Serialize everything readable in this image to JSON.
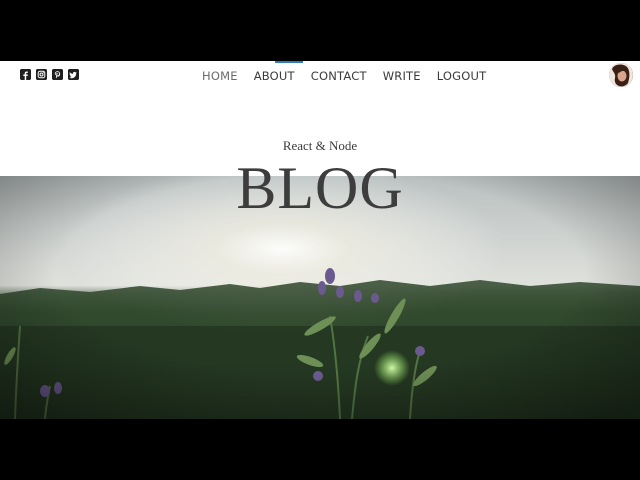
{
  "social": {
    "icons": [
      "facebook-square-icon",
      "instagram-icon",
      "pinterest-square-icon",
      "twitter-square-icon"
    ]
  },
  "nav": {
    "items": [
      {
        "label": "HOME"
      },
      {
        "label": "ABOUT"
      },
      {
        "label": "CONTACT"
      },
      {
        "label": "WRITE"
      },
      {
        "label": "LOGOUT"
      }
    ]
  },
  "header": {
    "subtitle": "React & Node",
    "title": "BLOG"
  },
  "colors": {
    "background": "#ffffff",
    "text": "#3d3d3d",
    "accent": "#2f7fb0"
  }
}
